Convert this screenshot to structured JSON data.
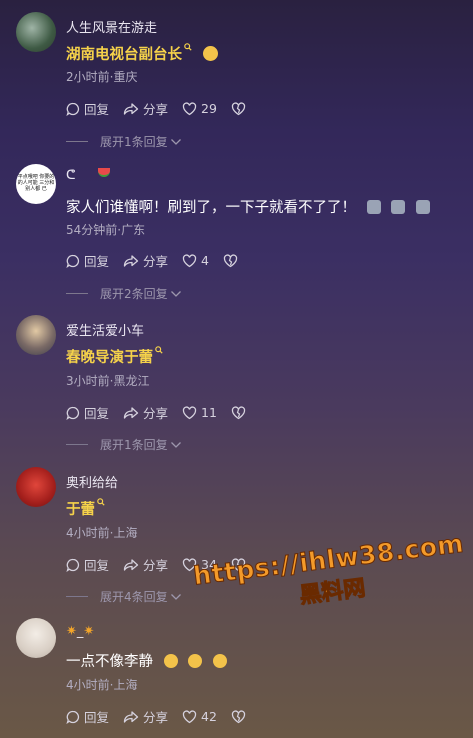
{
  "comments": [
    {
      "username": "人生风景在游走",
      "content": "湖南电视台副台长",
      "time_location": "2小时前·重庆",
      "reply_label": "回复",
      "share_label": "分享",
      "likes": "29",
      "expand_label": "展开1条回复"
    },
    {
      "username": "ᕦ",
      "avatar_text": "平点哦吧 你要的的人可能 三分和别人都 已",
      "content": "家人们谁懂啊！刷到了，一下子就看不了了！",
      "time_location": "54分钟前·广东",
      "reply_label": "回复",
      "share_label": "分享",
      "likes": "4",
      "expand_label": "展开2条回复"
    },
    {
      "username": "爱生活爱小车",
      "content": "春晚导演于蕾",
      "time_location": "3小时前·黑龙江",
      "reply_label": "回复",
      "share_label": "分享",
      "likes": "11",
      "expand_label": "展开1条回复"
    },
    {
      "username": "奥利给给",
      "content": "于蕾",
      "time_location": "4小时前·上海",
      "reply_label": "回复",
      "share_label": "分享",
      "likes": "34",
      "expand_label": "展开4条回复"
    },
    {
      "username": "_",
      "content": "一点不像李静",
      "time_location": "4小时前·上海",
      "reply_label": "回复",
      "share_label": "分享",
      "likes": "42"
    }
  ],
  "watermark": {
    "url": "https://ihlw38.com",
    "name": "黑料网"
  },
  "colors": {
    "link": "#f6d24a",
    "watermark": "#f39a2a"
  }
}
